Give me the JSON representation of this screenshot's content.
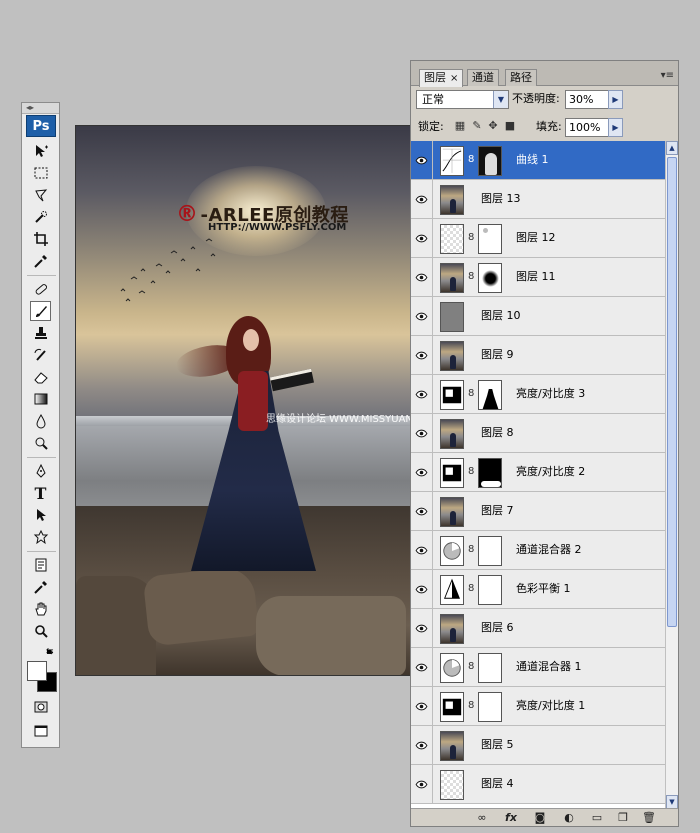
{
  "toolbox": {
    "logo": "Ps",
    "tools": [
      "move-tool",
      "marquee-tool",
      "lasso-tool",
      "quick-selection-tool",
      "crop-tool",
      "eyedropper-tool",
      "healing-brush-tool",
      "brush-tool",
      "clone-stamp-tool",
      "history-brush-tool",
      "eraser-tool",
      "gradient-tool",
      "blur-tool",
      "dodge-tool",
      "pen-tool",
      "type-tool",
      "path-selection-tool",
      "shape-tool",
      "notes-tool",
      "eyedropper-2-tool",
      "hand-tool",
      "zoom-tool"
    ],
    "type_glyph": "T",
    "active_tool": "brush-tool",
    "foreground_color": "#ffffff",
    "background_color": "#000000"
  },
  "canvas": {
    "watermark_reg": "®",
    "watermark_title": "-ARLEE原创教程",
    "watermark_url": "HTTP://WWW.PSFLY.COM",
    "watermark_forum": "思缘设计论坛 WWW.MISSYUAN.COM"
  },
  "layers_panel": {
    "tabs": [
      {
        "label": "图层",
        "active": true,
        "close": "×"
      },
      {
        "label": "通道",
        "active": false
      },
      {
        "label": "路径",
        "active": false
      }
    ],
    "menu_glyph": "▾≡",
    "blend_mode": "正常",
    "opacity_label": "不透明度:",
    "opacity_value": "30%",
    "lock_label": "锁定:",
    "fill_label": "填充:",
    "fill_value": "100%",
    "layers": [
      {
        "name": "曲线 1",
        "type": "curves",
        "mask": "figure",
        "selected": true
      },
      {
        "name": "图层 13",
        "type": "photo"
      },
      {
        "name": "图层 12",
        "type": "checker",
        "mask": "white-spot"
      },
      {
        "name": "图层 11",
        "type": "photo",
        "mask": "black-blob"
      },
      {
        "name": "图层 10",
        "type": "gray"
      },
      {
        "name": "图层 9",
        "type": "photo"
      },
      {
        "name": "亮度/对比度 3",
        "type": "brightness",
        "mask": "figure-black"
      },
      {
        "name": "图层 8",
        "type": "photo"
      },
      {
        "name": "亮度/对比度 2",
        "type": "brightness",
        "mask": "black"
      },
      {
        "name": "图层 7",
        "type": "photo"
      },
      {
        "name": "通道混合器 2",
        "type": "mixer",
        "mask": "white"
      },
      {
        "name": "色彩平衡 1",
        "type": "balance",
        "mask": "white"
      },
      {
        "name": "图层 6",
        "type": "photo"
      },
      {
        "name": "通道混合器 1",
        "type": "mixer",
        "mask": "white"
      },
      {
        "name": "亮度/对比度 1",
        "type": "brightness",
        "mask": "white"
      },
      {
        "name": "图层 5",
        "type": "photo"
      },
      {
        "name": "图层 4",
        "type": "checker"
      }
    ],
    "bottom_icons": [
      "link-layers-icon",
      "fx-icon",
      "add-mask-icon",
      "adjustment-icon",
      "new-group-icon",
      "new-layer-icon",
      "delete-layer-icon"
    ],
    "bottom_labels": {
      "fx": "fx"
    }
  }
}
